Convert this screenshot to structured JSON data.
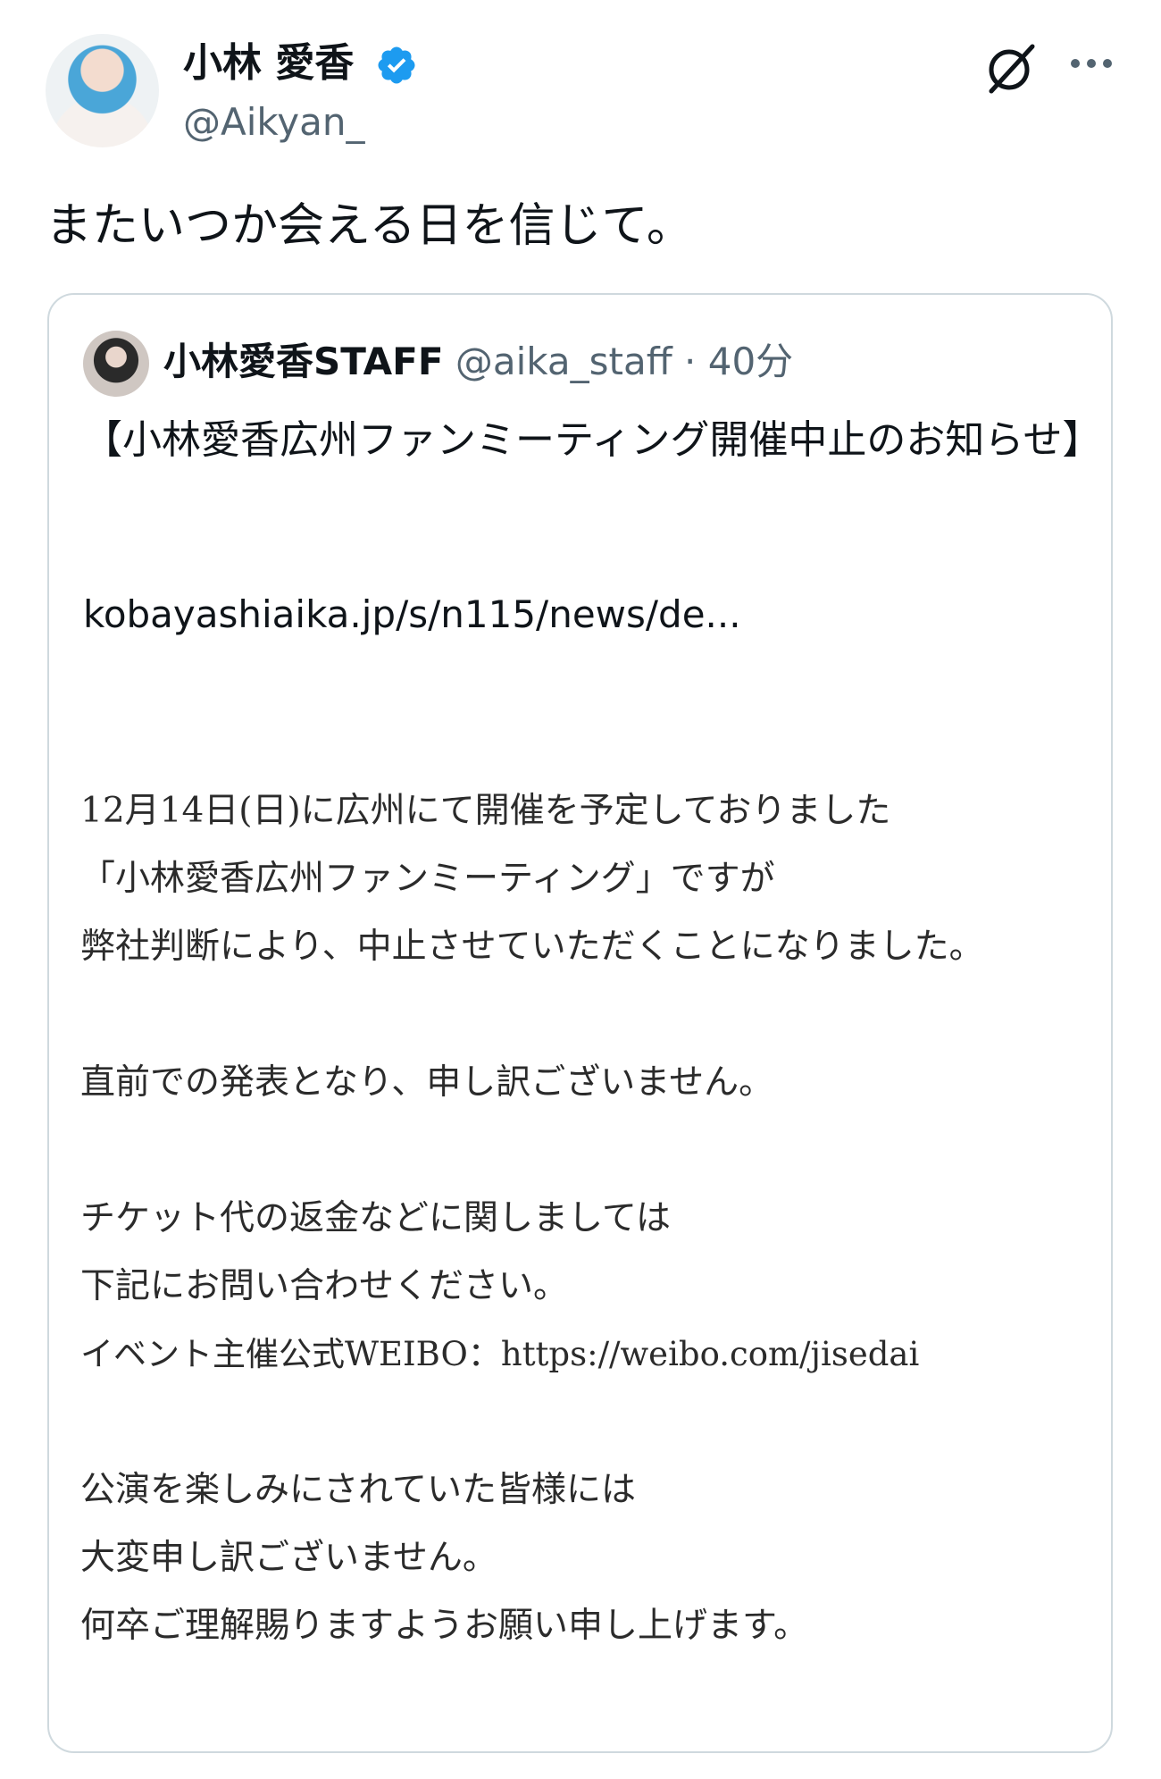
{
  "author": {
    "display_name": "小林 愛香",
    "handle": "@Aikyan_"
  },
  "tweet": {
    "text": "またいつか会える日を信じて。"
  },
  "quote": {
    "display_name": "小林愛香STAFF",
    "handle": "@aika_staff",
    "separator": "·",
    "time": "40分",
    "title": "【小林愛香広州ファンミーティング開催中止のお知らせ】",
    "link": "kobayashiaika.jp/s/n115/news/de..."
  },
  "notice": {
    "lines": [
      "12月14日(日)に広州にて開催を予定しておりました",
      "「小林愛香広州ファンミーティング」ですが",
      "弊社判断により、中止させていただくことになりました。",
      "",
      "直前での発表となり、申し訳ございません。",
      "",
      "チケット代の返金などに関しましては",
      "下記にお問い合わせください。",
      "イベント主催公式WEIBO：https://weibo.com/jisedai",
      "",
      "公演を楽しみにされていた皆様には",
      "大変申し訳ございません。",
      "何卒ご理解賜りますようお願い申し上げます。"
    ]
  },
  "icons": {
    "verified": "verified-badge-icon",
    "grok": "grok-icon",
    "more": "more-options-icon"
  },
  "colors": {
    "verified_blue": "#1d9bf0",
    "text_primary": "#0f1419",
    "text_secondary": "#536471",
    "card_border": "#cfd9de"
  }
}
